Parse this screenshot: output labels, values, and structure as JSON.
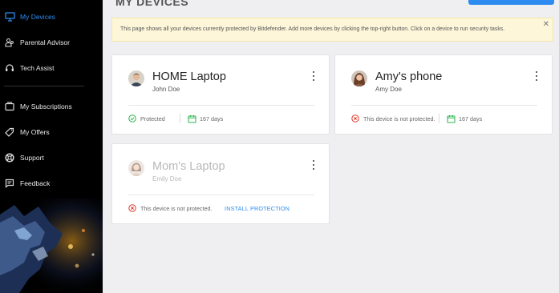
{
  "sidebar": {
    "items": [
      {
        "label": "My Devices",
        "icon": "monitor-icon",
        "active": true
      },
      {
        "label": "Parental Advisor",
        "icon": "parental-icon"
      },
      {
        "label": "Tech Assist",
        "icon": "headset-icon"
      },
      {
        "label": "My Subscriptions",
        "icon": "subscriptions-icon"
      },
      {
        "label": "My Offers",
        "icon": "tag-icon"
      },
      {
        "label": "Support",
        "icon": "lifebuoy-icon"
      },
      {
        "label": "Feedback",
        "icon": "chat-icon"
      }
    ]
  },
  "main": {
    "title": "MY DEVICES",
    "notice": "This page shows all your devices currently protected by Bitdefender. Add more devices by clicking the top-right button. Click on a device to run security tasks.",
    "close_glyph": "✕"
  },
  "devices": [
    {
      "name": "HOME Laptop",
      "owner": "John Doe",
      "status": "Protected",
      "days": "167 days",
      "protected": true
    },
    {
      "name": "Amy's phone",
      "owner": "Amy Doe",
      "status": "This device is not protected.",
      "days": "167 days",
      "protected": false
    },
    {
      "name": "Mom's Laptop",
      "owner": "Emily Doe",
      "status": "This device is not protected.",
      "action": "INSTALL PROTECTION",
      "protected": false
    }
  ],
  "colors": {
    "accent": "#2e8cf0",
    "protected": "#29b34a",
    "unprotected": "#e0392b",
    "sidebar_bg": "#000000",
    "notice_bg": "#fdf6d9"
  }
}
